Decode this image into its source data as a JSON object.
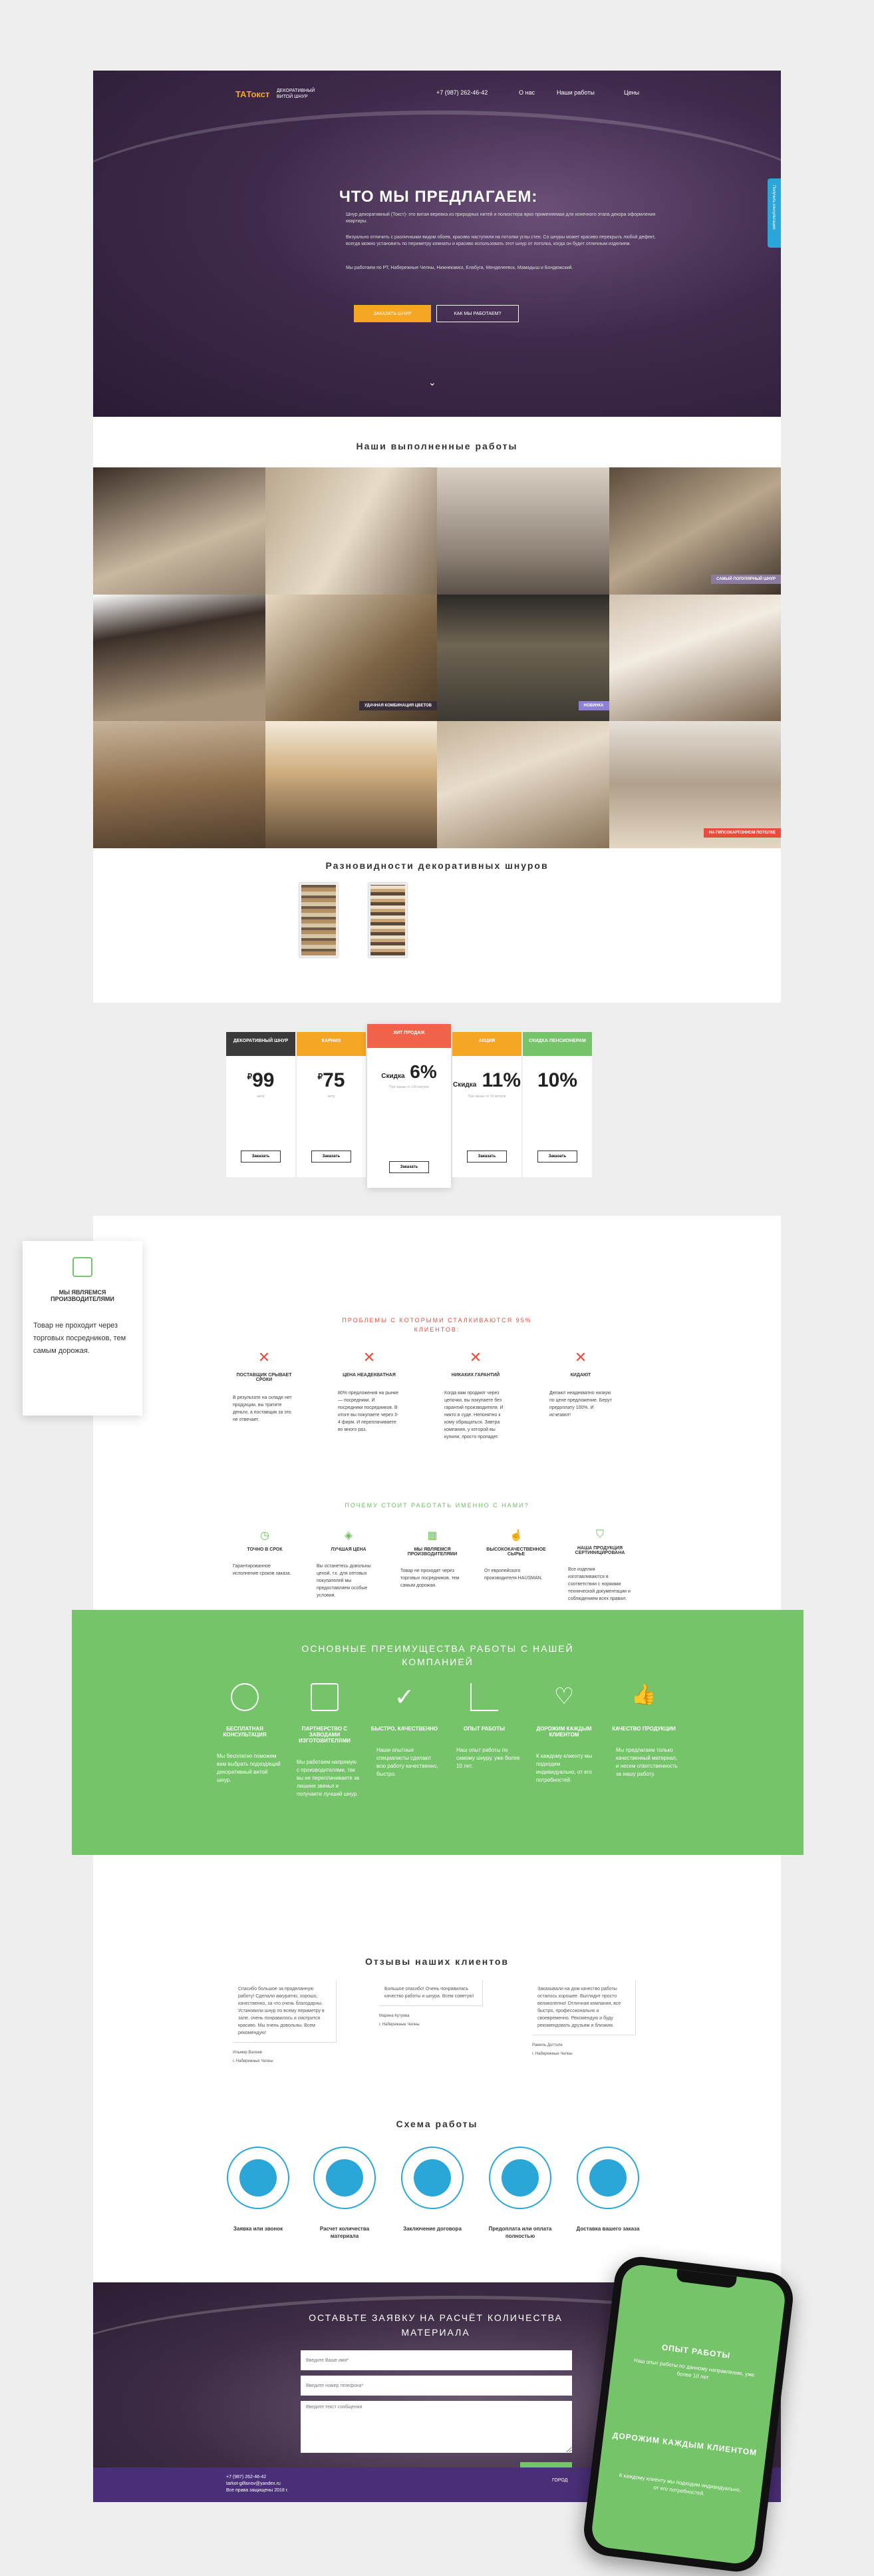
{
  "nav": {
    "logo": "TAТокст",
    "logo_sub": "Декоративный витой шнур",
    "phone": "+7 (987) 262-46-42",
    "links": [
      "О нас",
      "Наши работы",
      "Цены"
    ]
  },
  "hero": {
    "title": "Что мы предлагаем:",
    "text1": "Шнур декоративный (Токст)- это витая веревка из природных нитей и полиэстера ярко применяемая для конечного этапа декора оформления квартиры.",
    "text2": "Визуально отличить с различными видом обоев, красиво наступили на потолки углы стен. Со шнуры может красиво перекрыть любой дефект, всегда можно установить по периметру комнаты и красиво использовать этот шнур от потолка, когда он будет отличным изделием.",
    "text3": "Мы работаем по РТ, Набережные Челны, Нижнекамск, Елабуга, Менделеевск, Мамадыш и Бондюжский.",
    "btn_primary": "Заказать шнур",
    "btn_secondary": "Как мы работаем?",
    "side_tab": "Получить консультацию"
  },
  "works": {
    "title": "Наши выполненные работы",
    "captions": [
      "Самый популярный шнур",
      "Удачная комбинация цветов",
      "Новинка",
      "На гипсокартонном потолке"
    ]
  },
  "cords": {
    "title": "Разновидности декоративных шнуров"
  },
  "pricing": [
    {
      "head": "Декоративный шнур",
      "price": "99",
      "currency": "₽",
      "sub": "метр",
      "btn": "Заказать",
      "color": "#3a3a3a"
    },
    {
      "head": "Карниз",
      "price": "75",
      "currency": "₽",
      "sub": "метр",
      "btn": "Заказать",
      "color": "#f5a623"
    },
    {
      "head": "Хит продаж",
      "price": "6%",
      "prefix": "Скидка",
      "sub": "При заказе от 100 метров",
      "btn": "Заказать",
      "color": "#f0624a"
    },
    {
      "head": "Акция",
      "price": "11%",
      "prefix": "Скидка",
      "sub": "При заказе от 50 метров",
      "btn": "Заказать",
      "color": "#f5a623"
    },
    {
      "head": "Скидка Пенсионерам",
      "price": "10%",
      "sub": "",
      "btn": "Заказать",
      "color": "#75c469"
    }
  ],
  "float_card": {
    "title": "Мы являемся производителями",
    "text": "Товар не проходит через торговых посредников, тем самым дорожая."
  },
  "problems": {
    "title": "Проблемы с которыми сталкиваются 95% клиентов:",
    "items": [
      {
        "title": "Поставщик срывает сроки",
        "text": "В результате на складе нет продукции, вы тратите деньги, а поставщик за это не отвечает."
      },
      {
        "title": "Цена неадекватная",
        "text": "80% предложения на рынке — посредники. И посредники посредников. В итоге вы покупаете через 3-4 фирм. И переплачиваете во много раз."
      },
      {
        "title": "Никаких гарантий",
        "text": "Когда вам продают через цепочки, вы покупаете без гарантий производителя. И никто в суде. Непонятно к кому обращаться. Завтра компания, у которой вы купили, просто пропадет."
      },
      {
        "title": "Кидают",
        "text": "Делают неадекватно низкую по цене предложение. Берут предоплату 100%. И исчезают!"
      }
    ]
  },
  "why": {
    "title": "Почему стоит работать именно с нами?",
    "items": [
      {
        "title": "Точно в срок",
        "text": "Гарантированное исполнение сроков заказа."
      },
      {
        "title": "Лучшая цена",
        "text": "Вы останетесь довольны ценой, т.к. для оптовых покупателей мы предоставляем особые условия."
      },
      {
        "title": "Мы являемся производителями",
        "text": "Товар не проходит через торговых посредников, тем самым дорожая."
      },
      {
        "title": "Высококачественное сырье",
        "text": "От европейского производителя HAUSMAN."
      },
      {
        "title": "Наша продукция сертифицирована",
        "text": "Все изделия изготавливаются в соответствии с нормами технической документации и соблюдением всех правил."
      }
    ]
  },
  "advantages": {
    "title": "Основные преимущества работы с нашей компанией",
    "items": [
      {
        "title": "Бесплатная консультация",
        "text": "Мы бесплатно поможем вам выбрать подходящий декоративный витой шнур."
      },
      {
        "title": "Партнерство с заводами изготовителями",
        "text": "Мы работаем напрямую с производителями, так вы не переплачиваете за лишние звенья и получаете лучший шнур."
      },
      {
        "title": "Быстро, качественно",
        "text": "Наши опытные специалисты сделают всю работу качественно, быстро."
      },
      {
        "title": "Опыт работы",
        "text": "Наш опыт работы по самому шнуру, уже более 10 лет."
      },
      {
        "title": "Дорожим каждым клиентом",
        "text": "К каждому клиенту мы подходим индивидуально, от его потребностей."
      },
      {
        "title": "Качество продукции",
        "text": "Мы предлагаем только качественный материал, и несем ответственность за нашу работу."
      }
    ]
  },
  "reviews": {
    "title": "Отзывы наших клиентов",
    "items": [
      {
        "text": "Спасибо большое за проделанную работу! Сделали аккуратно, хорошо, качественно, за что очень благодарны. Установили шнур по всему периметру в зале, очень понравилось и смотрится красиво. Мы очень довольны. Всем рекомендую!",
        "name": "Ильмир Валеев",
        "city": "г. Набережные Челны"
      },
      {
        "text": "Большое спасибо! Очень понравилась качество работы и шнура. Всем советую!",
        "name": "Марина Кутуева",
        "city": "г. Набережные Челны"
      },
      {
        "text": "Заказывали на дом качество работы осталось хорошее. Выглядит просто великолепно! Отличная компания, все быстро, профессионально и своевременно. Рекомендую и буду рекомендовать друзьям и близким.",
        "name": "Рамиль Доттоле",
        "city": "г. Набережные Челны"
      }
    ]
  },
  "scheme": {
    "title": "Схема работы",
    "steps": [
      "Заявка или звонок",
      "Расчет количества материала",
      "Заключение договора",
      "Предоплата или оплата полностью",
      "Доставка вашего заказа"
    ]
  },
  "form": {
    "title": "Оставьте заявку на расчёт количества материала",
    "name_ph": "Введите Ваше имя*",
    "phone_ph": "Введите номер телефона*",
    "text_ph": "Введите текст сообщения",
    "send": "Заказать"
  },
  "footer": {
    "phone": "+7 (987) 262-46-42",
    "email": "tarkot-gilfanov@yandex.ru",
    "copy": "Все права защищены 2018 г.",
    "logo": "ГОРОД"
  },
  "phone_mock": {
    "title1": "Опыт работы",
    "text1": "Наш опыт работы по данному направлению, уже более 10 лет.",
    "title2": "Дорожим каждым клиентом",
    "text2": "К каждому клиенту мы подходим индивидуально, от его потребностей."
  },
  "colors": {
    "accent_orange": "#f5a623",
    "accent_green": "#75c469",
    "accent_red": "#e84c3d",
    "accent_blue": "#2aa6d8",
    "hero_purple": "#3f2a4c"
  }
}
